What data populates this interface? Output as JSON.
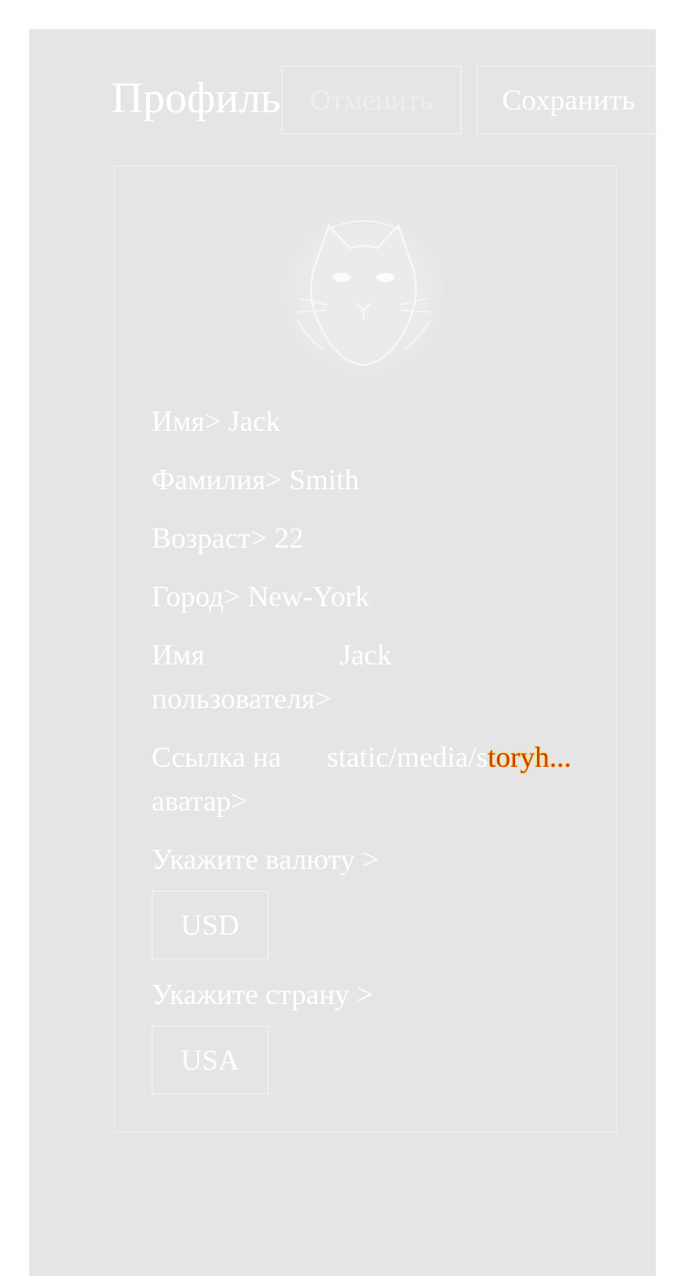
{
  "header": {
    "title": "Профиль",
    "cancel_label": "Отменить",
    "save_label": "Сохранить"
  },
  "profile": {
    "first_name_label": "Имя>",
    "first_name_value": "Jack",
    "last_name_label": "Фамилия>",
    "last_name_value": "Smith",
    "age_label": "Возраст>",
    "age_value": "22",
    "city_label": "Город>",
    "city_value": "New-York",
    "username_label": "Имя пользователя>",
    "username_value": "Jack",
    "avatar_link_label": "Ссылка на аватар>",
    "avatar_link_value_prefix": "static/media/s",
    "avatar_link_value_suffix": "toryh...",
    "currency_label": "Укажите валюту >",
    "currency_value": "USD",
    "country_label": "Укажите страну >",
    "country_value": "USA"
  },
  "icons": {
    "avatar": "cat-avatar-icon"
  }
}
